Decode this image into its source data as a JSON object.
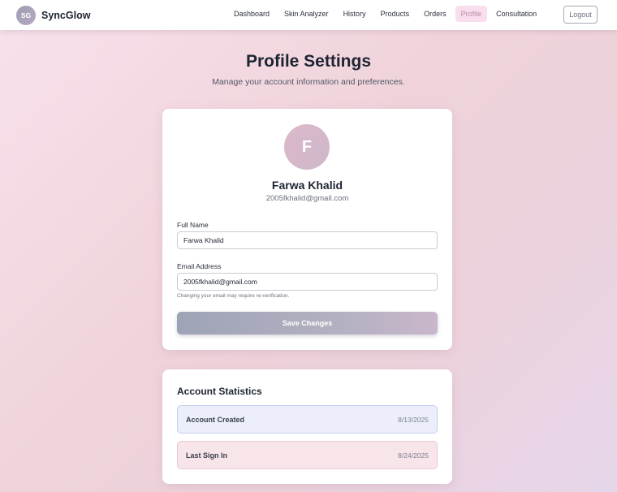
{
  "brand": {
    "badge": "SG",
    "name": "SyncGlow"
  },
  "nav": {
    "items": [
      {
        "label": "Dashboard"
      },
      {
        "label": "Skin Analyzer"
      },
      {
        "label": "History"
      },
      {
        "label": "Products"
      },
      {
        "label": "Orders"
      },
      {
        "label": "Profile",
        "active": true
      },
      {
        "label": "Consultation"
      }
    ],
    "logout_label": "Logout"
  },
  "header": {
    "title": "Profile Settings",
    "subtitle": "Manage your account information and preferences."
  },
  "profile": {
    "avatar_initial": "F",
    "name": "Farwa Khalid",
    "email": "2005fkhalid@gmail.com",
    "full_name_label": "Full Name",
    "full_name_value": "Farwa Khalid",
    "email_label": "Email Address",
    "email_value": "2005fkhalid@gmail.com",
    "email_hint": "Changing your email may require re-verification.",
    "save_label": "Save Changes"
  },
  "stats": {
    "title": "Account Statistics",
    "rows": [
      {
        "label": "Account Created",
        "value": "8/13/2025"
      },
      {
        "label": "Last Sign In",
        "value": "8/24/2025"
      }
    ]
  },
  "colors": {
    "nav_active_bg": "#f9dfee",
    "nav_active_text": "#b58aa6",
    "stat_blue_bg": "#eceefc",
    "stat_pink_bg": "#f8e5ea"
  }
}
